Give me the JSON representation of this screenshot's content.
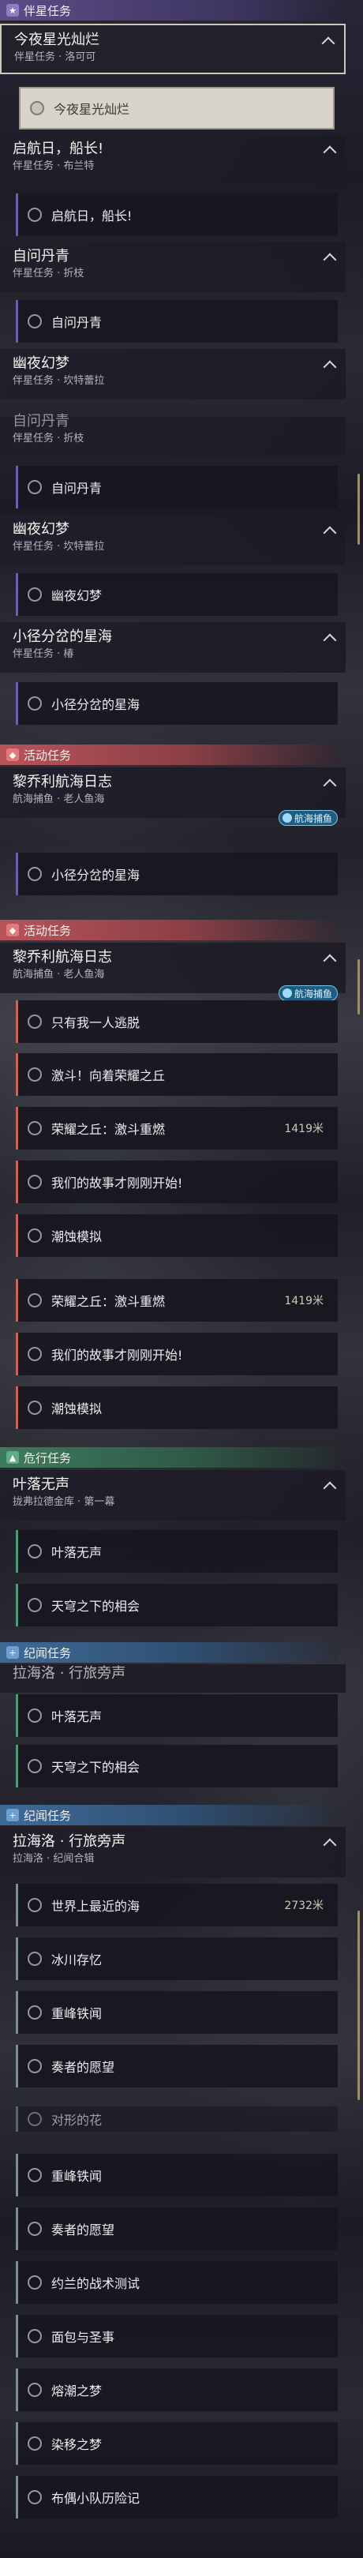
{
  "categories": {
    "companion": "伴星任务",
    "event": "活动任务",
    "danger": "危行任务",
    "legend": "纪闻任务"
  },
  "quests": [
    {
      "title": "今夜星光灿烂",
      "sub": "伴星任务 · 洛可可"
    },
    {
      "title": "启航日，船长!",
      "sub": "伴星任务 · 布兰特"
    },
    {
      "title": "自问丹青",
      "sub": "伴星任务 · 折枝"
    },
    {
      "title": "幽夜幻梦",
      "sub": "伴星任务 · 坎特蕾拉"
    },
    {
      "title": "自问丹青",
      "sub": "伴星任务 · 折枝"
    },
    {
      "title": "幽夜幻梦",
      "sub": "伴星任务 · 坎特蕾拉"
    },
    {
      "title": "小径分岔的星海",
      "sub": "伴星任务 · 椿"
    },
    {
      "title": "黎乔利航海日志",
      "sub": "航海捕鱼 · 老人鱼海"
    },
    {
      "title": "黎乔利航海日志",
      "sub": "航海捕鱼 · 老人鱼海"
    },
    {
      "title": "叶落无声",
      "sub": "拢弗拉德金库 · 第一幕"
    },
    {
      "title": "拉海洛 · 行旅旁声",
      "sub": ""
    },
    {
      "title": "拉海洛 · 行旅旁声",
      "sub": "拉海洛 · 纪闻合辑"
    }
  ],
  "badge": "航海捕鱼",
  "steps": {
    "s1": "今夜星光灿烂",
    "s2": "启航日，船长!",
    "s3": "自问丹青",
    "s4": "自问丹青",
    "s5": "幽夜幻梦",
    "s6": "小径分岔的星海",
    "s7": "小径分岔的星海",
    "s8": "只有我一人逃脱",
    "s9": "激斗！向着荣耀之丘",
    "s10": "荣耀之丘：激斗重燃",
    "s11": "我们的故事才刚刚开始!",
    "s12": "潮蚀模拟",
    "s13": "荣耀之丘：激斗重燃",
    "s14": "我们的故事才刚刚开始!",
    "s15": "潮蚀模拟",
    "s16": "叶落无声",
    "s17": "天穹之下的相会",
    "s18": "叶落无声",
    "s19": "天穹之下的相会",
    "s20": "世界上最近的海",
    "s21": "冰川存忆",
    "s22": "重峰铁闻",
    "s23": "奏者的愿望",
    "s24": "对形的花",
    "s25": "重峰铁闻",
    "s26": "奏者的愿望",
    "s27": "约兰的战术测试",
    "s28": "面包与圣事",
    "s29": "熔潮之梦",
    "s30": "染移之梦",
    "s31": "布偶小队历险记"
  },
  "distances": {
    "d1": "1419米",
    "d2": "1419米",
    "d3": "2732米"
  }
}
